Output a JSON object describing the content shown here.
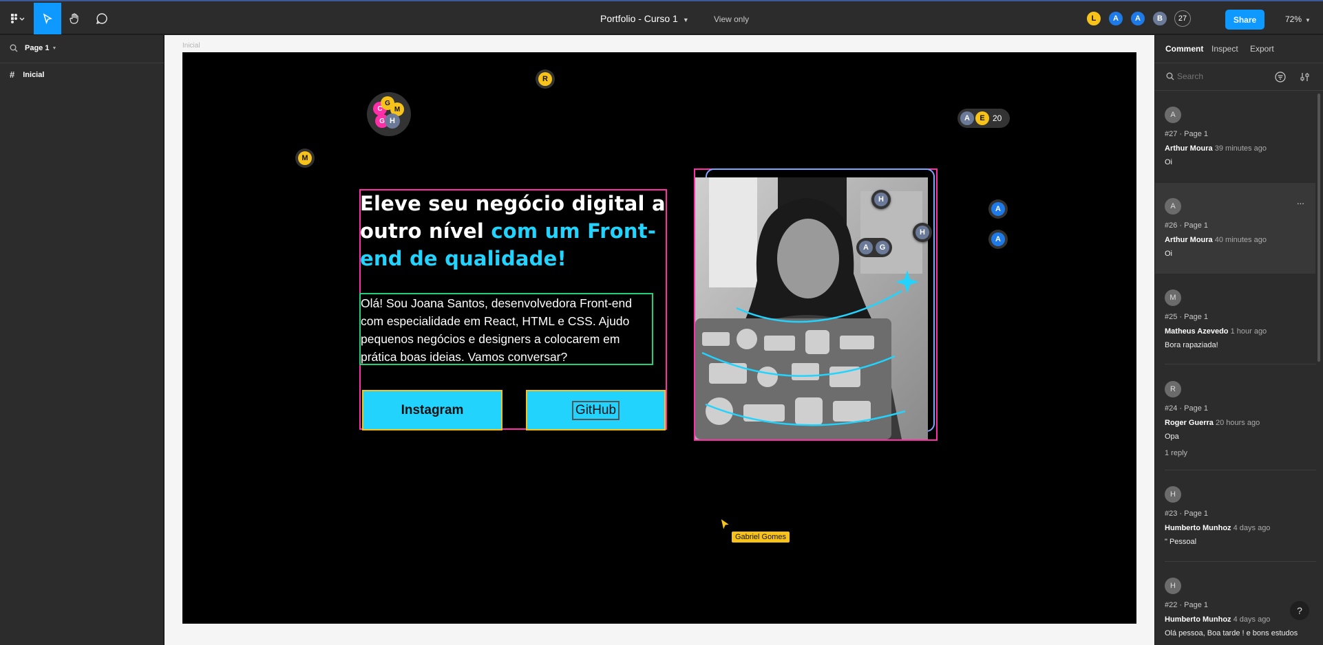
{
  "app": {
    "title": "Portfolio - Curso 1",
    "view_mode": "View only",
    "share_label": "Share",
    "zoom": "72%",
    "collaborators": [
      {
        "initial": "L",
        "color": "#f7c31a"
      },
      {
        "initial": "A",
        "color": "#1e7ae6"
      },
      {
        "initial": "A",
        "color": "#1e7ae6"
      },
      {
        "initial": "B",
        "color": "#6c7a99"
      }
    ],
    "collaborators_extra": "27",
    "accent": "#0d99ff"
  },
  "toolbar": {
    "icons": [
      "figma-menu-icon",
      "move-tool-icon",
      "hand-tool-icon",
      "comment-tool-icon",
      "present-icon"
    ]
  },
  "left_panel": {
    "page_label": "Page 1",
    "layers": [
      {
        "name": "Inicial",
        "icon": "frame-icon"
      }
    ]
  },
  "canvas": {
    "frame_label": "Inicial",
    "headline_white": "Eleve seu negócio digital a outro nível ",
    "headline_cyan": "com um Front-end de qualidade!",
    "paragraph": "Olá! Sou Joana Santos, desenvolvedora Front-end com especialidade em React, HTML e CSS. Ajudo pequenos negócios e designers a colocarem em prática boas ideias. Vamos conversar?",
    "button_instagram": "Instagram",
    "button_github": "GitHub",
    "cursor_user": "Gabriel Gomes",
    "cyan": "#22d4fd",
    "magenta": "#ff2fa8",
    "cursor_color": "#f7c31a",
    "pins": {
      "r": "R",
      "m": "M",
      "h1": "H",
      "h2": "H",
      "a1": "A",
      "a2": "A",
      "cluster": [
        "C",
        "G",
        "M",
        "G",
        "H"
      ],
      "group1": [
        "A",
        "G"
      ],
      "group2": [
        "A",
        "E"
      ],
      "group2_count": "20"
    }
  },
  "right_panel": {
    "tabs": [
      "Comment",
      "Inspect",
      "Export"
    ],
    "search_placeholder": "Search",
    "comments": [
      {
        "avatar": "A",
        "number": "#27 · Page 1",
        "author": "Arthur Moura",
        "time": "39 minutes ago",
        "text": "Oi",
        "replies": ""
      },
      {
        "avatar": "A",
        "number": "#26 · Page 1",
        "author": "Arthur Moura",
        "time": "40 minutes ago",
        "text": "Oi",
        "replies": ""
      },
      {
        "avatar": "M",
        "number": "#25 · Page 1",
        "author": "Matheus Azevedo",
        "time": "1 hour ago",
        "text": "Bora rapaziada!",
        "replies": ""
      },
      {
        "avatar": "R",
        "number": "#24 · Page 1",
        "author": "Roger Guerra",
        "time": "20 hours ago",
        "text": "Opa",
        "replies": "1 reply"
      },
      {
        "avatar": "H",
        "number": "#23 · Page 1",
        "author": "Humberto Munhoz",
        "time": "4 days ago",
        "text": "\" Pessoal",
        "replies": ""
      },
      {
        "avatar": "H",
        "number": "#22 · Page 1",
        "author": "Humberto Munhoz",
        "time": "4 days ago",
        "text": "Olá pessoa, Boa tarde ! e bons estudos",
        "replies": ""
      }
    ],
    "more_label": "...",
    "help_label": "?"
  }
}
